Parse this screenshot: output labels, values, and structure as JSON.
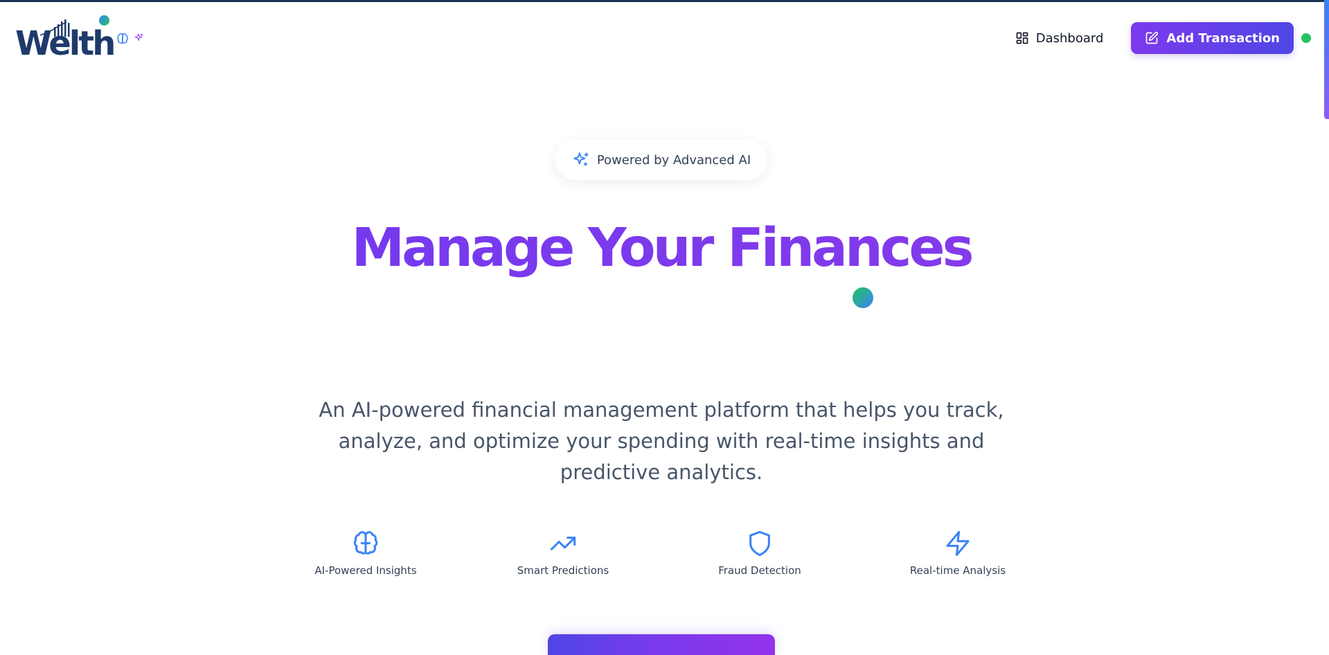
{
  "brand": {
    "name": "Welth",
    "colors": {
      "navy": "#1e3a6b",
      "purple": "#7c3aed",
      "indigo": "#4f46e5",
      "blue": "#3b82f6",
      "green": "#22c55e"
    }
  },
  "header": {
    "logo_text": "Welth",
    "icons": [
      "brain-icon",
      "sparkle-icon"
    ],
    "nav": {
      "dashboard_label": "Dashboard",
      "dashboard_icon": "layout-grid-icon",
      "add_transaction_label": "Add Transaction",
      "add_transaction_icon": "pen-square-icon",
      "status": "online"
    }
  },
  "hero": {
    "badge_label": "Powered by Advanced AI",
    "badge_icon": "sparkles-icon",
    "title": "Manage Your Finances",
    "description": "An AI-powered financial management platform that helps you track, analyze, and optimize your spending with real-time insights and predictive analytics."
  },
  "features": [
    {
      "label": "AI-Powered Insights",
      "icon": "brain-icon"
    },
    {
      "label": "Smart Predictions",
      "icon": "trending-up-icon"
    },
    {
      "label": "Fraud Detection",
      "icon": "shield-icon"
    },
    {
      "label": "Real-time Analysis",
      "icon": "zap-icon"
    }
  ]
}
